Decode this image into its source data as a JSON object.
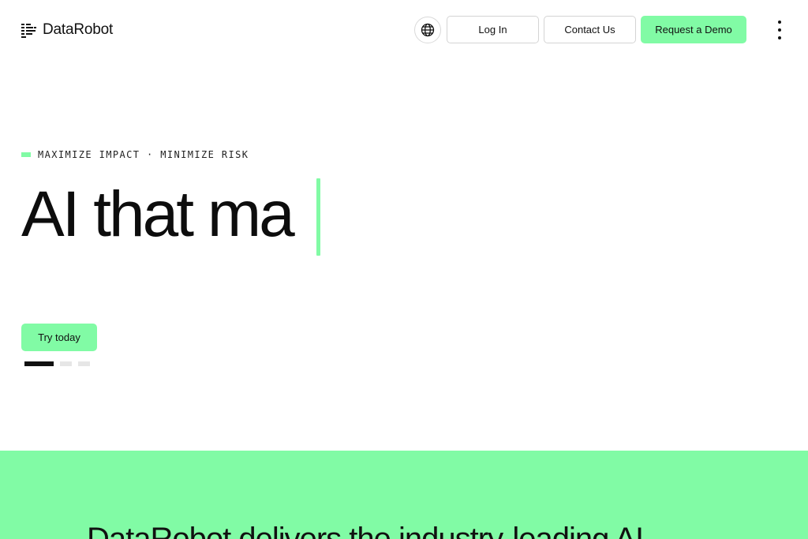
{
  "brand": {
    "name": "DataRobot"
  },
  "header": {
    "language_icon": "globe-icon",
    "login_label": "Log In",
    "contact_label": "Contact Us",
    "demo_label": "Request a Demo",
    "menu_icon": "more-vertical-icon"
  },
  "hero": {
    "eyebrow": "MAXIMIZE IMPACT · MINIMIZE RISK",
    "headline": "AI that ma",
    "cta_label": "Try today",
    "slides": {
      "count": 3,
      "active": 1
    }
  },
  "band": {
    "text": "DataRobot delivers the industry-leading AI"
  },
  "colors": {
    "accent": "#81fba5",
    "text": "#111111",
    "background": "#ffffff"
  }
}
